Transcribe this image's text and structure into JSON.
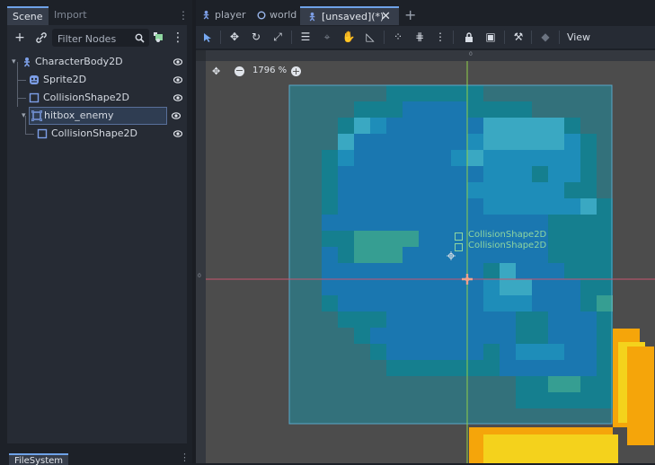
{
  "dock": {
    "tabs": [
      {
        "label": "Scene",
        "active": true
      },
      {
        "label": "Import",
        "active": false
      }
    ],
    "filter_placeholder": "Filter Nodes",
    "tree": [
      {
        "label": "CharacterBody2D",
        "icon": "character-body-icon",
        "depth": 0,
        "expanded": true
      },
      {
        "label": "Sprite2D",
        "icon": "sprite-icon",
        "depth": 1
      },
      {
        "label": "CollisionShape2D",
        "icon": "collision-shape-icon",
        "depth": 1
      },
      {
        "label": "hitbox_enemy",
        "icon": "area-icon",
        "depth": 1,
        "expanded": true,
        "selected": true
      },
      {
        "label": "CollisionShape2D",
        "icon": "collision-shape-icon",
        "depth": 2
      }
    ],
    "bottom_tab": "FileSystem"
  },
  "editor_tabs": [
    {
      "label": "player",
      "icon": "character-body-icon"
    },
    {
      "label": "world",
      "icon": "node2d-icon"
    },
    {
      "label": "[unsaved](*)",
      "icon": "character-body-icon",
      "active": true
    }
  ],
  "toolbar": {
    "view_label": "View"
  },
  "viewport": {
    "zoom_label": "1796 %",
    "overlay_labels": [
      "CollisionShape2D",
      "CollisionShape2D"
    ],
    "ruler_zero": "0"
  },
  "colors": {
    "accent": "#6ea2e8",
    "selection_fill": "#1f8fa3",
    "axis_x": "#c7566f",
    "axis_y": "#8fcf4a"
  }
}
